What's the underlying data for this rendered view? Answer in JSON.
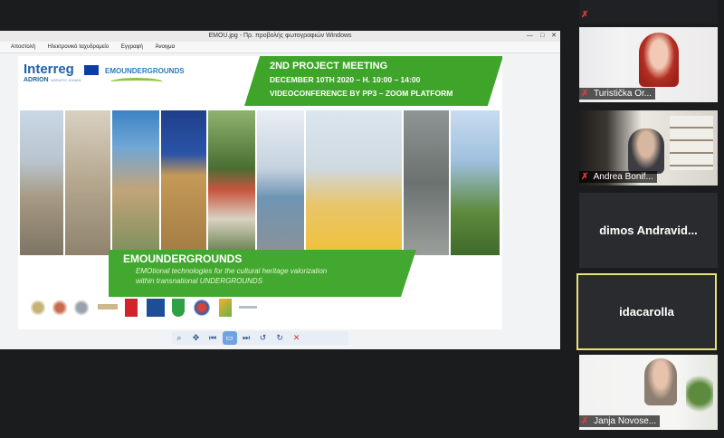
{
  "viewer": {
    "title": "EMOU.jpg - Πρ. προβολής φωτογραφιών Windows",
    "window_controls": [
      "—",
      "□",
      "✕"
    ],
    "menu": [
      "Αποστολή",
      "Ηλεκτρονικό ταχυδρομείο",
      "Εγγραφή",
      "Άνοιγμα"
    ],
    "toolbar_icons": [
      "zoom-icon",
      "fit-icon",
      "previous-icon",
      "slideshow-icon",
      "next-icon",
      "rotate-left-icon",
      "rotate-right-icon",
      "delete-icon"
    ],
    "toolbar_glyphs": [
      "⌕",
      "✥",
      "⏮",
      "▭",
      "⏭",
      "↺",
      "↻",
      "✕"
    ]
  },
  "slide": {
    "logo_interreg": "Interreg",
    "logo_adrion": "ADRION",
    "logo_program": "ADRIATIC-IONIAN",
    "logo_emou": "EMOUNDERGROUNDS",
    "meeting_title": "2ND PROJECT MEETING",
    "meeting_date": "DECEMBER 10TH 2020 – H. 10:00 – 14:00",
    "meeting_place": "VIDEOCONFERENCE BY PP3 – ZOOM PLATFORM",
    "project_name": "EMOUNDERGROUNDS",
    "project_tagline_1": "EMOtional technologies for the cultural heritage valorization",
    "project_tagline_2": "within transnational UNDERGROUNDS"
  },
  "participants": [
    {
      "name": "",
      "muted": true,
      "video": false
    },
    {
      "name": "Turistička Or...",
      "muted": true,
      "video": true
    },
    {
      "name": "Andrea Bonif...",
      "muted": true,
      "video": true
    },
    {
      "name": "dimos  Andravid...",
      "muted": false,
      "video": false
    },
    {
      "name": "idacarolla",
      "muted": false,
      "video": false,
      "active_speaker": true
    },
    {
      "name": "Janja Novose...",
      "muted": true,
      "video": true
    }
  ],
  "colors": {
    "accent_green": "#3fa52a",
    "active_border": "#e8e27a",
    "muted_mic": "#e03b3b"
  }
}
